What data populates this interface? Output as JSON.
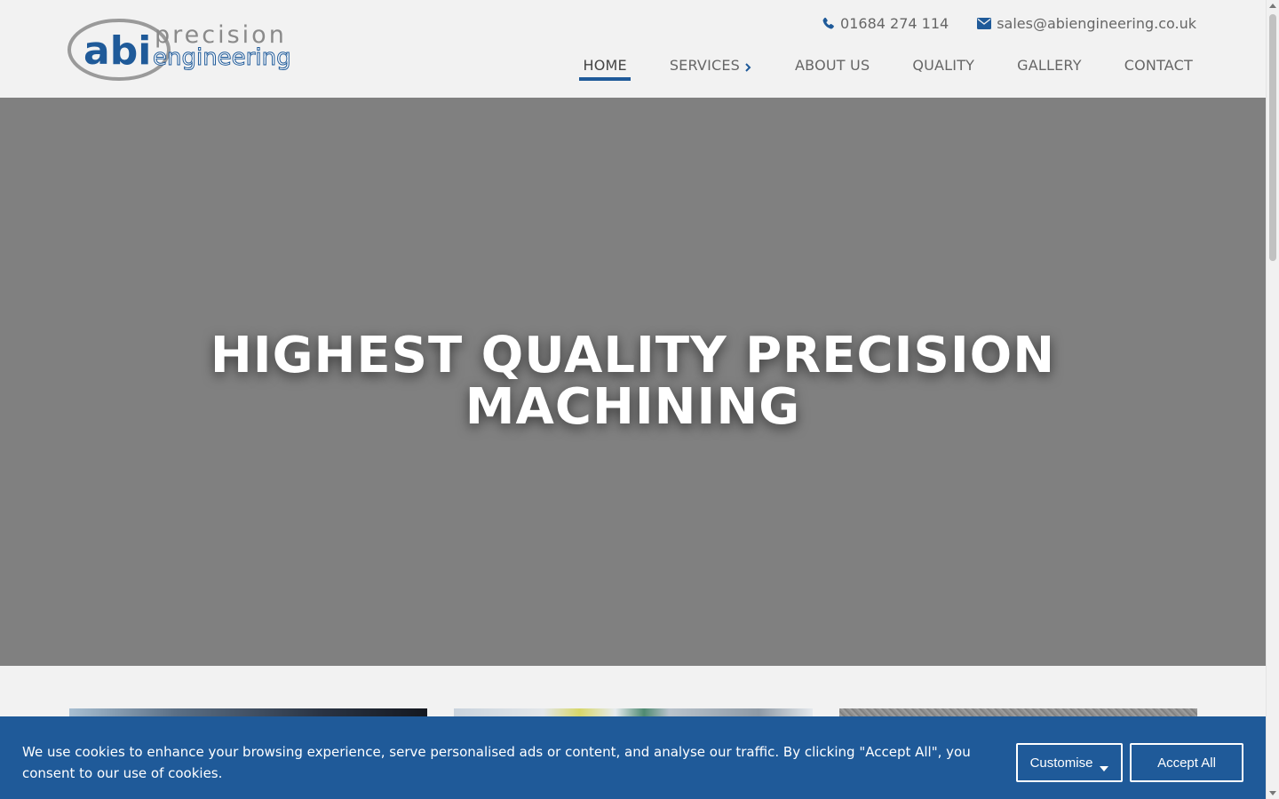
{
  "brand": {
    "logo_word_1": "abi",
    "logo_word_2": "precision",
    "logo_word_3": "engineering",
    "primary_color": "#1f5a99",
    "logo_gray": "#8a8a8a"
  },
  "header": {
    "phone": "01684 274 114",
    "email": "sales@abiengineering.co.uk",
    "phone_icon": "phone-icon",
    "email_icon": "envelope-icon"
  },
  "nav": {
    "items": [
      {
        "label": "HOME",
        "active": true
      },
      {
        "label": "SERVICES",
        "has_submenu": true
      },
      {
        "label": "ABOUT US"
      },
      {
        "label": "QUALITY"
      },
      {
        "label": "GALLERY"
      },
      {
        "label": "CONTACT"
      }
    ]
  },
  "hero": {
    "title_line_1": "HIGHEST QUALITY PRECISION",
    "title_line_2": "MACHINING",
    "background": "#808080"
  },
  "cookie": {
    "message": "We use cookies to enhance your browsing experience, serve personalised ads or content, and analyse our traffic. By clicking \"Accept All\", you consent to our use of cookies.",
    "customise_label": "Customise",
    "accept_label": "Accept All",
    "background": "#1f5a99"
  }
}
